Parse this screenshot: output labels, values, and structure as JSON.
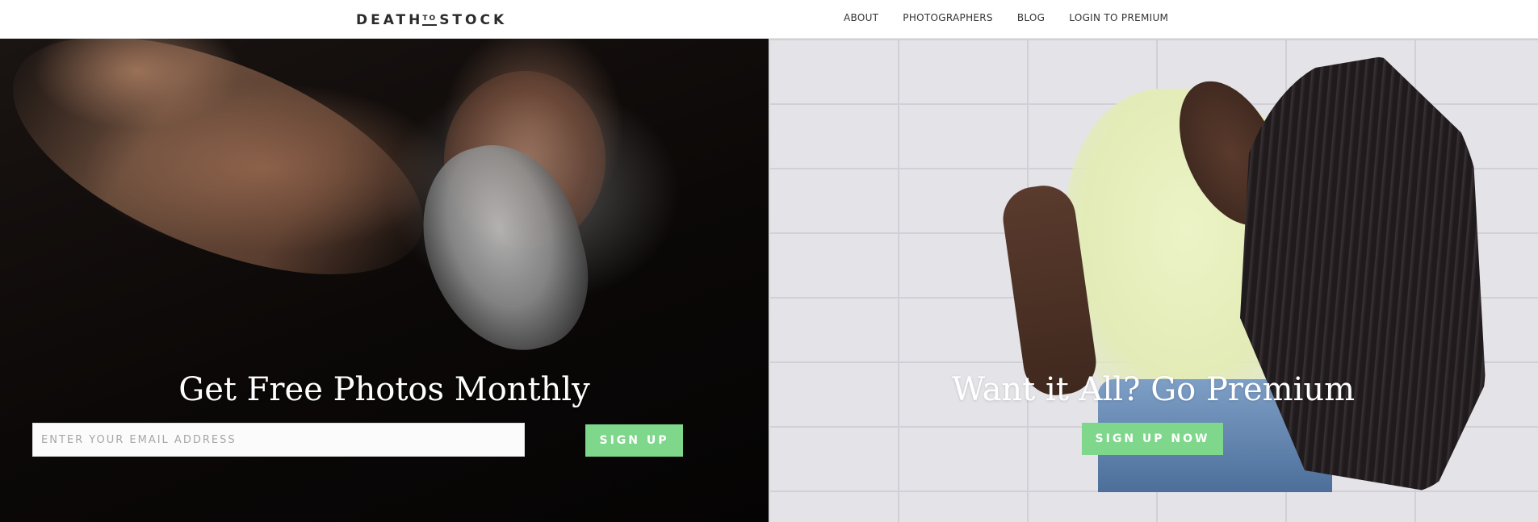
{
  "header": {
    "logo": {
      "part1": "DEATH",
      "part2": "TO",
      "part3": "STOCK"
    },
    "nav": [
      {
        "label": "ABOUT"
      },
      {
        "label": "PHOTOGRAPHERS"
      },
      {
        "label": "BLOG"
      },
      {
        "label": "LOGIN TO PREMIUM"
      }
    ]
  },
  "left_panel": {
    "headline": "Get Free Photos Monthly",
    "email_placeholder": "ENTER YOUR EMAIL ADDRESS",
    "signup_label": "SIGN UP"
  },
  "right_panel": {
    "headline": "Want it All? Go Premium",
    "signup_label": "SIGN UP NOW"
  },
  "colors": {
    "accent": "#7ed78a",
    "nav_text": "#333333",
    "headline_text": "#ffffff"
  }
}
